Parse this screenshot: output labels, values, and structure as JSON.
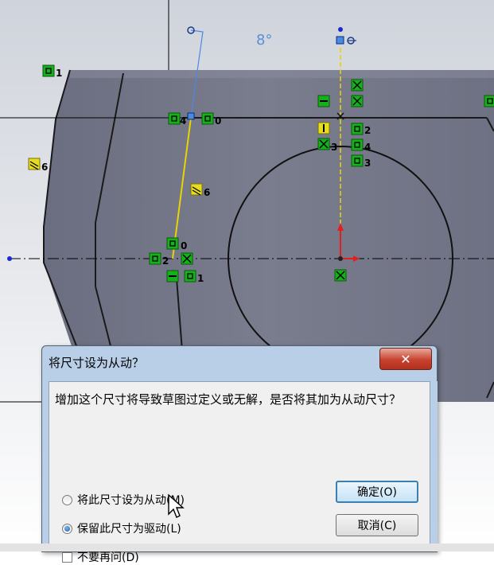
{
  "viewport": {
    "angle_label": "8°",
    "relation_badges": [
      {
        "id": "b1",
        "label": "1"
      },
      {
        "id": "b2",
        "label": "6"
      },
      {
        "id": "b3",
        "label": "4"
      },
      {
        "id": "b4",
        "label": "0"
      },
      {
        "id": "b5",
        "label": "6"
      },
      {
        "id": "b6",
        "label": "0"
      },
      {
        "id": "b7",
        "label": "2"
      },
      {
        "id": "b8",
        "label": "1"
      },
      {
        "id": "b9",
        "label": "2"
      },
      {
        "id": "b10",
        "label": "3"
      },
      {
        "id": "b11",
        "label": "4"
      },
      {
        "id": "b12",
        "label": "3"
      }
    ]
  },
  "dialog": {
    "title": "将尺寸设为从动？",
    "close_glyph": "✕",
    "message": "增加这个尺寸将导致草图过定义或无解，是否将其加为从动尺寸？",
    "options": [
      {
        "label": "将此尺寸设为从动(M)",
        "selected": false
      },
      {
        "label": "保留此尺寸为驱动(L)",
        "selected": true
      }
    ],
    "checkbox_label": "不要再问(D)",
    "ok_label": "确定(O)",
    "cancel_label": "取消(C)"
  }
}
